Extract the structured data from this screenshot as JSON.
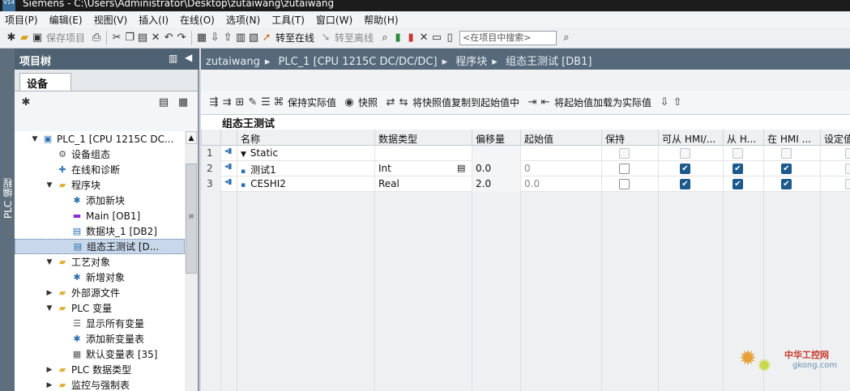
{
  "window": {
    "logo": "V14",
    "title": "Siemens - C:\\Users\\Administrator\\Desktop\\zutaiwang\\zutaiwang"
  },
  "menu": [
    "项目(P)",
    "编辑(E)",
    "视图(V)",
    "插入(I)",
    "在线(O)",
    "选项(N)",
    "工具(T)",
    "窗口(W)",
    "帮助(H)"
  ],
  "toolbar": {
    "save_label": "保存项目",
    "go_online": "转至在线",
    "go_offline": "转至离线",
    "search_placeholder": "<在项目中搜索>"
  },
  "project_tree": {
    "title": "项目树",
    "side_label": "PLC 编程",
    "devices_tab": "设备",
    "items": [
      {
        "label": "PLC_1 [CPU 1215C DC...",
        "level": 1,
        "expand": "open",
        "icon": "plc-icon"
      },
      {
        "label": "设备组态",
        "level": 2,
        "expand": "",
        "icon": "device-config-icon"
      },
      {
        "label": "在线和诊断",
        "level": 2,
        "expand": "",
        "icon": "diagnostics-icon"
      },
      {
        "label": "程序块",
        "level": 2,
        "expand": "open",
        "icon": "folder-icon"
      },
      {
        "label": "添加新块",
        "level": 3,
        "expand": "",
        "icon": "add-block-icon"
      },
      {
        "label": "Main [OB1]",
        "level": 3,
        "expand": "",
        "icon": "ob-icon"
      },
      {
        "label": "数据块_1 [DB2]",
        "level": 3,
        "expand": "",
        "icon": "db-icon"
      },
      {
        "label": "组态王测试 [D...",
        "level": 3,
        "expand": "",
        "icon": "db-icon",
        "selected": true
      },
      {
        "label": "工艺对象",
        "level": 2,
        "expand": "open",
        "icon": "folder-icon"
      },
      {
        "label": "新增对象",
        "level": 3,
        "expand": "",
        "icon": "add-object-icon"
      },
      {
        "label": "外部源文件",
        "level": 2,
        "expand": "closed",
        "icon": "folder-icon"
      },
      {
        "label": "PLC 变量",
        "level": 2,
        "expand": "open",
        "icon": "folder-icon"
      },
      {
        "label": "显示所有变量",
        "level": 3,
        "expand": "",
        "icon": "show-tags-icon"
      },
      {
        "label": "添加新变量表",
        "level": 3,
        "expand": "",
        "icon": "add-tag-table-icon"
      },
      {
        "label": "默认变量表 [35]",
        "level": 3,
        "expand": "",
        "icon": "tag-table-icon"
      },
      {
        "label": "PLC 数据类型",
        "level": 2,
        "expand": "closed",
        "icon": "folder-icon"
      },
      {
        "label": "监控与强制表",
        "level": 2,
        "expand": "closed",
        "icon": "folder-icon"
      }
    ]
  },
  "breadcrumb": [
    "zutaiwang",
    "PLC_1 [CPU 1215C DC/DC/DC]",
    "程序块",
    "组态王测试 [DB1]"
  ],
  "editor_toolbar": {
    "keep_actual": "保持实际值",
    "snapshot": "快照",
    "copy_snapshot": "将快照值复制到起始值中",
    "load_start": "将起始值加载为实际值"
  },
  "block_title": "组态王测试",
  "grid": {
    "headers": [
      "名称",
      "数据类型",
      "偏移量",
      "起始值",
      "保持",
      "可从 HMI/...",
      "从 H...",
      "在 HMI ...",
      "设定值"
    ],
    "rows": [
      {
        "num": "1",
        "name": "Static",
        "type": "",
        "offset": "",
        "start": "",
        "retain": false,
        "hmi_access": false,
        "from_hmi": false,
        "in_hmi": false,
        "is_group": true
      },
      {
        "num": "2",
        "name": "测试1",
        "type": "Int",
        "offset": "0.0",
        "start": "0",
        "retain": false,
        "hmi_access": true,
        "from_hmi": true,
        "in_hmi": true,
        "is_group": false
      },
      {
        "num": "3",
        "name": "CESHI2",
        "type": "Real",
        "offset": "2.0",
        "start": "0.0",
        "retain": false,
        "hmi_access": true,
        "from_hmi": true,
        "in_hmi": true,
        "is_group": false
      }
    ]
  },
  "watermark": {
    "text": "中华工控网",
    "url": "gkong.com"
  }
}
